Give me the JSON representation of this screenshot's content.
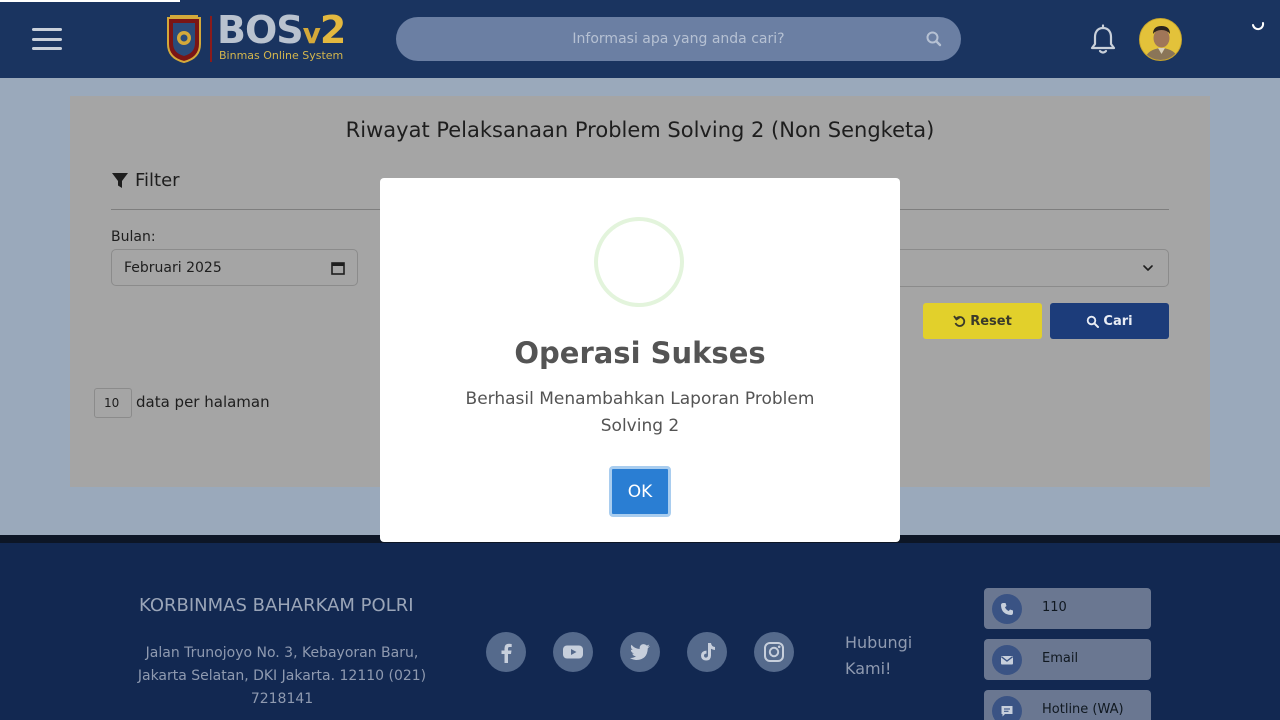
{
  "header": {
    "logo": {
      "title_main": "BOS",
      "title_v": "v",
      "title_num": "2",
      "subtitle": "Binmas Online System"
    },
    "search": {
      "placeholder": "Informasi apa yang anda cari?",
      "value": ""
    },
    "icons": [
      "hamburger-menu-icon",
      "search-icon",
      "bell-icon",
      "avatar",
      "loading-spinner-icon"
    ]
  },
  "page": {
    "title": "Riwayat Pelaksanaan Problem Solving 2 (Non Sengketa)",
    "filter": {
      "label": "Filter",
      "bulan_label": "Bulan:",
      "bulan_value": "Februari 2025",
      "select_value": "",
      "reset_label": "Reset",
      "cari_label": "Cari"
    },
    "pagination": {
      "per_page_value": "10",
      "per_page_label": "data per halaman"
    }
  },
  "modal": {
    "title": "Operasi Sukses",
    "text": "Berhasil Menambahkan Laporan Problem Solving 2",
    "ok_label": "OK"
  },
  "footer": {
    "org_name": "KORBINMAS BAHARKAM POLRI",
    "address": "Jalan Trunojoyo No. 3, Kebayoran Baru, Jakarta Selatan, DKI Jakarta. 12110 (021) 7218141",
    "social_icons": [
      "facebook-icon",
      "youtube-icon",
      "twitter-icon",
      "tiktok-icon",
      "instagram-icon"
    ],
    "hubungi": "Hubungi Kami!",
    "contacts": [
      {
        "icon": "phone-icon",
        "label": "110"
      },
      {
        "icon": "email-icon",
        "label": "Email"
      },
      {
        "icon": "chat-icon",
        "label": "Hotline (WA)"
      }
    ]
  },
  "colors": {
    "header_bg": "#1a3460",
    "footer_bg": "#122851",
    "reset_button": "#e2d02b",
    "cari_button": "#1c3c7a",
    "ok_button": "#2a7ed3",
    "overlay_card": "#a5a5a5"
  }
}
